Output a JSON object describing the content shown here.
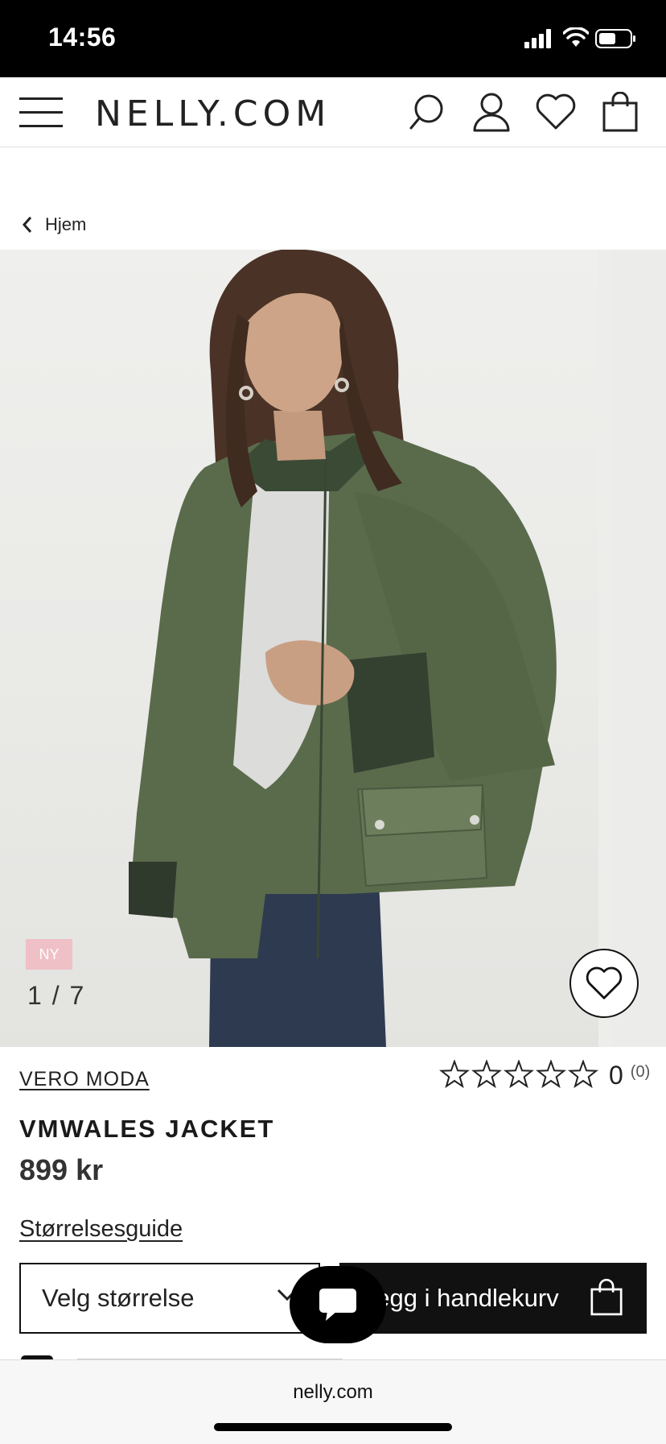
{
  "status_bar": {
    "time": "14:56"
  },
  "header": {
    "logo": "NELLY.COM",
    "icons": [
      "menu-icon",
      "search-icon",
      "account-icon",
      "wishlist-icon",
      "bag-icon"
    ]
  },
  "breadcrumb": {
    "label": "Hjem"
  },
  "gallery": {
    "badge": "NY",
    "counter": "1 / 7"
  },
  "product": {
    "brand": "VERO MODA",
    "name": "VMWALES JACKET",
    "price": "899 kr",
    "rating": {
      "stars": 0,
      "max": 5,
      "score": "0",
      "count": "(0)"
    },
    "size_guide": "Størrelsesguide",
    "size_select": "Velg størrelse",
    "add_to_cart": "Legg i handlekurv"
  },
  "browser": {
    "url": "nelly.com"
  },
  "colors": {
    "accent": "#111111",
    "badge": "#efc0c6",
    "jacket": "#5a6b4c"
  }
}
